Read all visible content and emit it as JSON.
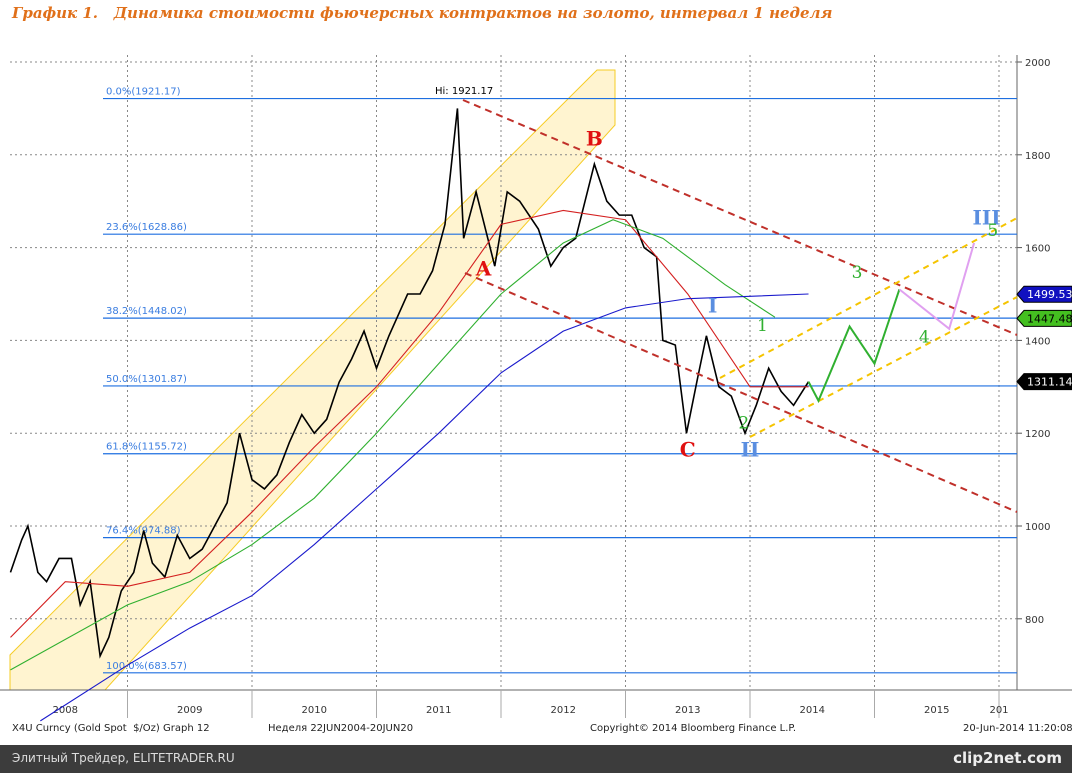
{
  "title": "График 1.   Динамика стоимости фьючерсных контрактов на золото, интервал 1 неделя",
  "footer": {
    "ticker": "X4U Curncy (Gold Spot  $/Oz) Graph 12",
    "period": "Неделя 22JUN2004-20JUN20",
    "copyright": "Copyright© 2014 Bloomberg Finance L.P.",
    "timestamp": "20-Jun-2014 11:20:08"
  },
  "watermark": {
    "left": "Элитный Трейдер, ELITETRADER.RU",
    "right": "clip2net.com"
  },
  "chart_data": {
    "type": "line",
    "xlim": [
      2008.06,
      2016.1
    ],
    "ylim": [
      660,
      2030
    ],
    "x_ticks": [
      {
        "label": "2008",
        "t": 2008.5
      },
      {
        "label": "2009",
        "t": 2009.5
      },
      {
        "label": "2010",
        "t": 2010.5
      },
      {
        "label": "2011",
        "t": 2011.5
      },
      {
        "label": "2012",
        "t": 2012.5
      },
      {
        "label": "2013",
        "t": 2013.5
      },
      {
        "label": "2014",
        "t": 2014.5
      },
      {
        "label": "2015",
        "t": 2015.5
      },
      {
        "label": "201",
        "t": 2016.0
      }
    ],
    "y_ticks": [
      800,
      1000,
      1200,
      1400,
      1600,
      1800,
      2000
    ],
    "series": [
      {
        "name": "Gold price",
        "color": "#000000",
        "points": [
          [
            2008.06,
            900
          ],
          [
            2008.15,
            970
          ],
          [
            2008.2,
            1000
          ],
          [
            2008.28,
            900
          ],
          [
            2008.35,
            880
          ],
          [
            2008.45,
            930
          ],
          [
            2008.55,
            930
          ],
          [
            2008.62,
            830
          ],
          [
            2008.7,
            880
          ],
          [
            2008.78,
            720
          ],
          [
            2008.85,
            760
          ],
          [
            2008.95,
            860
          ],
          [
            2009.05,
            900
          ],
          [
            2009.13,
            990
          ],
          [
            2009.2,
            920
          ],
          [
            2009.3,
            890
          ],
          [
            2009.4,
            980
          ],
          [
            2009.5,
            930
          ],
          [
            2009.6,
            950
          ],
          [
            2009.7,
            1000
          ],
          [
            2009.8,
            1050
          ],
          [
            2009.9,
            1200
          ],
          [
            2010.0,
            1100
          ],
          [
            2010.1,
            1080
          ],
          [
            2010.2,
            1110
          ],
          [
            2010.3,
            1180
          ],
          [
            2010.4,
            1240
          ],
          [
            2010.5,
            1200
          ],
          [
            2010.6,
            1230
          ],
          [
            2010.7,
            1310
          ],
          [
            2010.8,
            1360
          ],
          [
            2010.9,
            1420
          ],
          [
            2011.0,
            1340
          ],
          [
            2011.1,
            1410
          ],
          [
            2011.25,
            1500
          ],
          [
            2011.35,
            1500
          ],
          [
            2011.45,
            1550
          ],
          [
            2011.55,
            1650
          ],
          [
            2011.65,
            1900
          ],
          [
            2011.7,
            1620
          ],
          [
            2011.8,
            1720
          ],
          [
            2011.95,
            1560
          ],
          [
            2012.05,
            1720
          ],
          [
            2012.15,
            1700
          ],
          [
            2012.3,
            1640
          ],
          [
            2012.4,
            1560
          ],
          [
            2012.5,
            1600
          ],
          [
            2012.6,
            1620
          ],
          [
            2012.75,
            1780
          ],
          [
            2012.85,
            1700
          ],
          [
            2012.95,
            1670
          ],
          [
            2013.05,
            1670
          ],
          [
            2013.15,
            1600
          ],
          [
            2013.25,
            1580
          ],
          [
            2013.3,
            1400
          ],
          [
            2013.4,
            1390
          ],
          [
            2013.49,
            1200
          ],
          [
            2013.58,
            1320
          ],
          [
            2013.65,
            1410
          ],
          [
            2013.75,
            1300
          ],
          [
            2013.85,
            1280
          ],
          [
            2013.96,
            1200
          ],
          [
            2014.05,
            1260
          ],
          [
            2014.15,
            1340
          ],
          [
            2014.25,
            1290
          ],
          [
            2014.35,
            1260
          ],
          [
            2014.47,
            1311
          ]
        ]
      },
      {
        "name": "MA red",
        "color": "#d42020",
        "points": [
          [
            2008.06,
            760
          ],
          [
            2008.5,
            880
          ],
          [
            2009.0,
            870
          ],
          [
            2009.5,
            900
          ],
          [
            2010.0,
            1030
          ],
          [
            2010.5,
            1170
          ],
          [
            2011.0,
            1300
          ],
          [
            2011.5,
            1460
          ],
          [
            2012.0,
            1650
          ],
          [
            2012.5,
            1680
          ],
          [
            2013.0,
            1660
          ],
          [
            2013.5,
            1500
          ],
          [
            2014.0,
            1300
          ],
          [
            2014.47,
            1300
          ]
        ]
      },
      {
        "name": "MA green",
        "color": "#30b030",
        "points": [
          [
            2008.06,
            690
          ],
          [
            2009.0,
            830
          ],
          [
            2009.5,
            880
          ],
          [
            2010.0,
            960
          ],
          [
            2010.5,
            1060
          ],
          [
            2011.0,
            1200
          ],
          [
            2011.5,
            1350
          ],
          [
            2012.0,
            1500
          ],
          [
            2012.5,
            1610
          ],
          [
            2012.9,
            1660
          ],
          [
            2013.3,
            1620
          ],
          [
            2013.8,
            1520
          ],
          [
            2014.2,
            1450
          ]
        ]
      },
      {
        "name": "MA blue",
        "color": "#1a1acc",
        "points": [
          [
            2008.3,
            580
          ],
          [
            2009.0,
            700
          ],
          [
            2009.5,
            780
          ],
          [
            2010.0,
            850
          ],
          [
            2010.5,
            960
          ],
          [
            2011.0,
            1080
          ],
          [
            2011.5,
            1200
          ],
          [
            2012.0,
            1330
          ],
          [
            2012.5,
            1420
          ],
          [
            2013.0,
            1470
          ],
          [
            2013.5,
            1490
          ],
          [
            2014.0,
            1495
          ],
          [
            2014.47,
            1500
          ]
        ]
      }
    ],
    "fib_levels": [
      {
        "label": "0.0%(1921.17)",
        "value": 1921.17
      },
      {
        "label": "23.6%(1628.86)",
        "value": 1628.86
      },
      {
        "label": "38.2%(1448.02)",
        "value": 1448.02
      },
      {
        "label": "50.0%(1301.87)",
        "value": 1301.87
      },
      {
        "label": "61.8%(1155.72)",
        "value": 1155.72
      },
      {
        "label": "76.4%(974.88)",
        "value": 974.88
      },
      {
        "label": "100.0%(683.57)",
        "value": 683.57
      }
    ],
    "high_label": "Hi: 1921.17",
    "price_tags": [
      {
        "label": "1499.53",
        "value": 1499.53,
        "color": "#1010c0"
      },
      {
        "label": "1447.48",
        "value": 1447.48,
        "color": "#44c020"
      },
      {
        "label": "1311.14",
        "value": 1311.14,
        "color": "#000000"
      }
    ],
    "wave_labels": [
      {
        "text": "A",
        "t": 2011.86,
        "v": 1540,
        "color": "#e01010"
      },
      {
        "text": "B",
        "t": 2012.75,
        "v": 1820,
        "color": "#e01010"
      },
      {
        "text": "C",
        "t": 2013.5,
        "v": 1150,
        "color": "#e01010"
      },
      {
        "text": "I",
        "t": 2013.7,
        "v": 1460,
        "color": "#5a8ee0"
      },
      {
        "text": "II",
        "t": 2014.0,
        "v": 1150,
        "color": "#5a8ee0"
      },
      {
        "text": "III",
        "t": 2015.9,
        "v": 1650,
        "color": "#5a8ee0"
      },
      {
        "text": "1",
        "t": 2014.1,
        "v": 1420,
        "color": "#30b030"
      },
      {
        "text": "2",
        "t": 2013.95,
        "v": 1210,
        "color": "#30b030"
      },
      {
        "text": "3",
        "t": 2014.86,
        "v": 1535,
        "color": "#30b030"
      },
      {
        "text": "4",
        "t": 2015.4,
        "v": 1395,
        "color": "#30b030"
      },
      {
        "text": "5",
        "t": 2015.95,
        "v": 1625,
        "color": "#30b030"
      }
    ],
    "projection_green": [
      [
        2014.47,
        1311
      ],
      [
        2014.55,
        1270
      ],
      [
        2014.8,
        1430
      ],
      [
        2015.0,
        1350
      ],
      [
        2015.2,
        1510
      ]
    ],
    "projection_pink": [
      [
        2015.2,
        1510
      ],
      [
        2015.6,
        1425
      ],
      [
        2015.8,
        1610
      ]
    ]
  }
}
